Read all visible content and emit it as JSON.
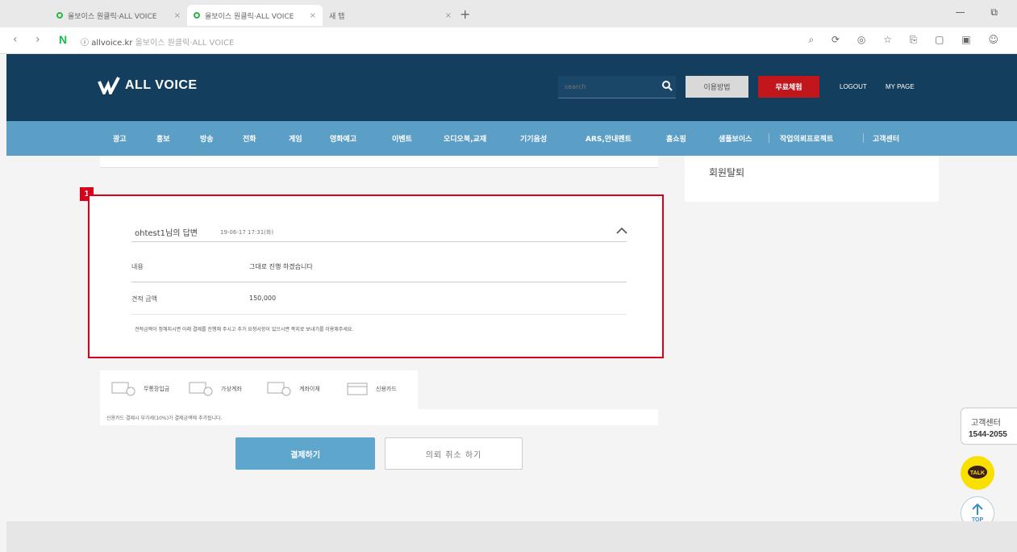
{
  "browser": {
    "tabs": [
      {
        "label": "올보이스 원클릭·ALL VOICE",
        "active": false
      },
      {
        "label": "올보이스 원클릭·ALL VOICE",
        "active": true
      },
      {
        "label": "새 탭",
        "active": false
      }
    ],
    "new_tab": "+",
    "window_controls": "— ⧉",
    "url_host": "allvoice.kr",
    "url_title": "올보이스 원클릭·ALL VOICE"
  },
  "header": {
    "brand": "ALL VOICE",
    "search_placeholder": "search",
    "guide_button": "이용방법",
    "free_button": "무료체험",
    "logout": "LOGOUT",
    "mypage": "MY PAGE"
  },
  "gnb": [
    "광고",
    "홍보",
    "방송",
    "전화",
    "게임",
    "영화예고",
    "이벤트",
    "오디오북,교재",
    "기기음성",
    "ARS,안내멘트",
    "홈쇼핑",
    "샘플보이스",
    "작업의뢰프로젝트",
    "고객센터"
  ],
  "sidebar": {
    "withdraw": "회원탈퇴"
  },
  "answer": {
    "marker": "1",
    "title": "ohtest1님의 답변",
    "date": "19-06-17 17:31(화)",
    "content_label": "내용",
    "content_value": "그대로 진행 하겠습니다",
    "amount_label": "견적 금액",
    "amount_value": "150,000",
    "notice": "견적금액이 정해지시면 아래 결제를 진행해 주시고 추가 요청사항이 있으시면 쪽지로 보내기를 이용해주세요."
  },
  "payment": {
    "options": [
      "무통장입금",
      "가상계좌",
      "계좌이체",
      "신용카드"
    ],
    "note": "신용카드 결제시 부가세(10%)가 결제금액에 추가됩니다.",
    "pay_button": "결제하기",
    "cancel_button": "의뢰 취소 하기"
  },
  "floating": {
    "cs_title": "고객센터",
    "cs_phone": "1544-2055",
    "talk": "TALK",
    "top": "TOP"
  },
  "colors": {
    "header_bg": "#143e5e",
    "gnb_bg": "#5b9ec6",
    "accent_red": "#c0161c",
    "highlight_red": "#d8001a",
    "pay_blue": "#5ea6cc",
    "talk_yellow": "#f9e000"
  }
}
